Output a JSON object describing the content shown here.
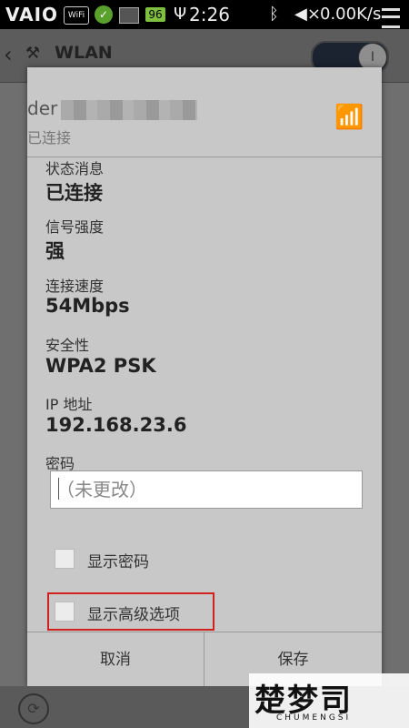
{
  "statusbar": {
    "brand": "VAIO",
    "wifi_badge": "WiFi",
    "battery": "96",
    "time": "2:26",
    "net_speed": "0.00K/s",
    "icons": [
      "wifi-icon",
      "app-icon",
      "image-icon",
      "battery-icon",
      "usb-icon",
      "bluetooth-icon",
      "mute-icon",
      "menu-icon"
    ]
  },
  "appbar": {
    "title": "WLAN",
    "toggle_state": "on"
  },
  "background_list": {
    "item_text": "der",
    "item_sub": "已连接"
  },
  "dialog": {
    "ssid_prefix": "der",
    "ssid_sub": "已连接",
    "fields": [
      {
        "label": "状态消息",
        "value": "已连接"
      },
      {
        "label": "信号强度",
        "value": "强"
      },
      {
        "label": "连接速度",
        "value": "54Mbps"
      },
      {
        "label": "安全性",
        "value": "WPA2 PSK"
      },
      {
        "label": "IP 地址",
        "value": "192.168.23.6"
      }
    ],
    "password_label": "密码",
    "password_placeholder": "（未更改）",
    "show_password": "显示密码",
    "show_advanced": "显示高级选项",
    "cancel": "取消",
    "save": "保存"
  },
  "watermark": {
    "main": "楚梦司",
    "sub": "CHUMENGSI"
  },
  "colors": {
    "dialog_bg": "#c8c8c8",
    "highlight": "#d21f1f",
    "statusbar": "#000000"
  }
}
